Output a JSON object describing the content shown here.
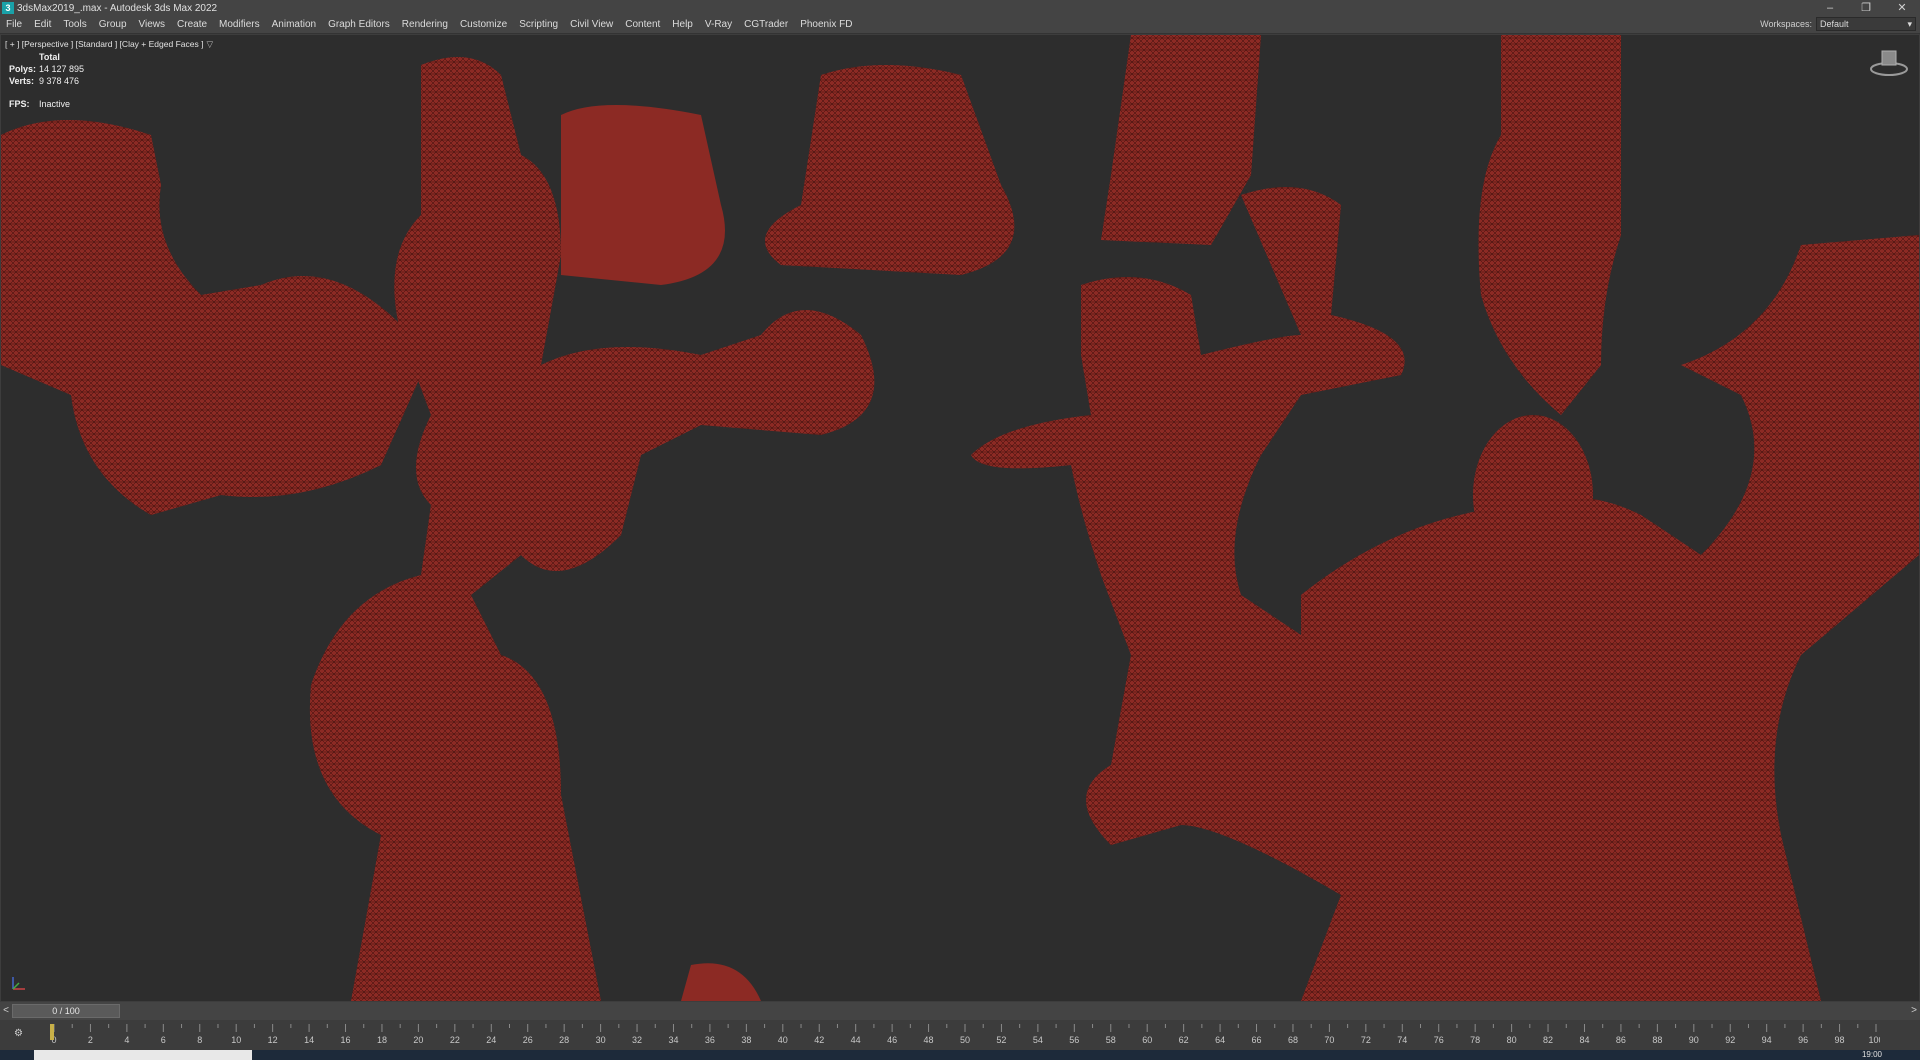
{
  "window": {
    "app_icon": "3",
    "title": "3dsMax2019_.max - Autodesk 3ds Max 2022",
    "controls": {
      "minimize": "–",
      "restore": "❐",
      "close": "✕"
    }
  },
  "menubar": {
    "items": [
      "File",
      "Edit",
      "Tools",
      "Group",
      "Views",
      "Create",
      "Modifiers",
      "Animation",
      "Graph Editors",
      "Rendering",
      "Customize",
      "Scripting",
      "Civil View",
      "Content",
      "Help",
      "V-Ray",
      "CGTrader",
      "Phoenix FD"
    ],
    "workspaces_label": "Workspaces:",
    "workspaces_value": "Default"
  },
  "viewport": {
    "label": "[ + ] [Perspective ] [Standard ] [Clay + Edged Faces ]",
    "stats": {
      "total_label": "Total",
      "polys_label": "Polys:",
      "polys_value": "14 127 895",
      "verts_label": "Verts:",
      "verts_value": "9 378 476"
    },
    "fps_label": "FPS:",
    "fps_value": "Inactive",
    "mesh_color": "#8c2a24",
    "background_color": "#2d2d2d"
  },
  "timeslider": {
    "prev": "<",
    "next": ">",
    "frame": "0 / 100"
  },
  "trackbar": {
    "ticks": [
      "0",
      "2",
      "4",
      "6",
      "8",
      "10",
      "12",
      "14",
      "16",
      "18",
      "20",
      "22",
      "24",
      "26",
      "28",
      "30",
      "32",
      "34",
      "36",
      "38",
      "40",
      "42",
      "44",
      "46",
      "48",
      "50",
      "52",
      "54",
      "56",
      "58",
      "60",
      "62",
      "64",
      "66",
      "68",
      "70",
      "72",
      "74",
      "76",
      "78",
      "80",
      "82",
      "84",
      "86",
      "88",
      "90",
      "92",
      "94",
      "96",
      "98",
      "100"
    ]
  },
  "taskbar": {
    "time": "19:00"
  }
}
